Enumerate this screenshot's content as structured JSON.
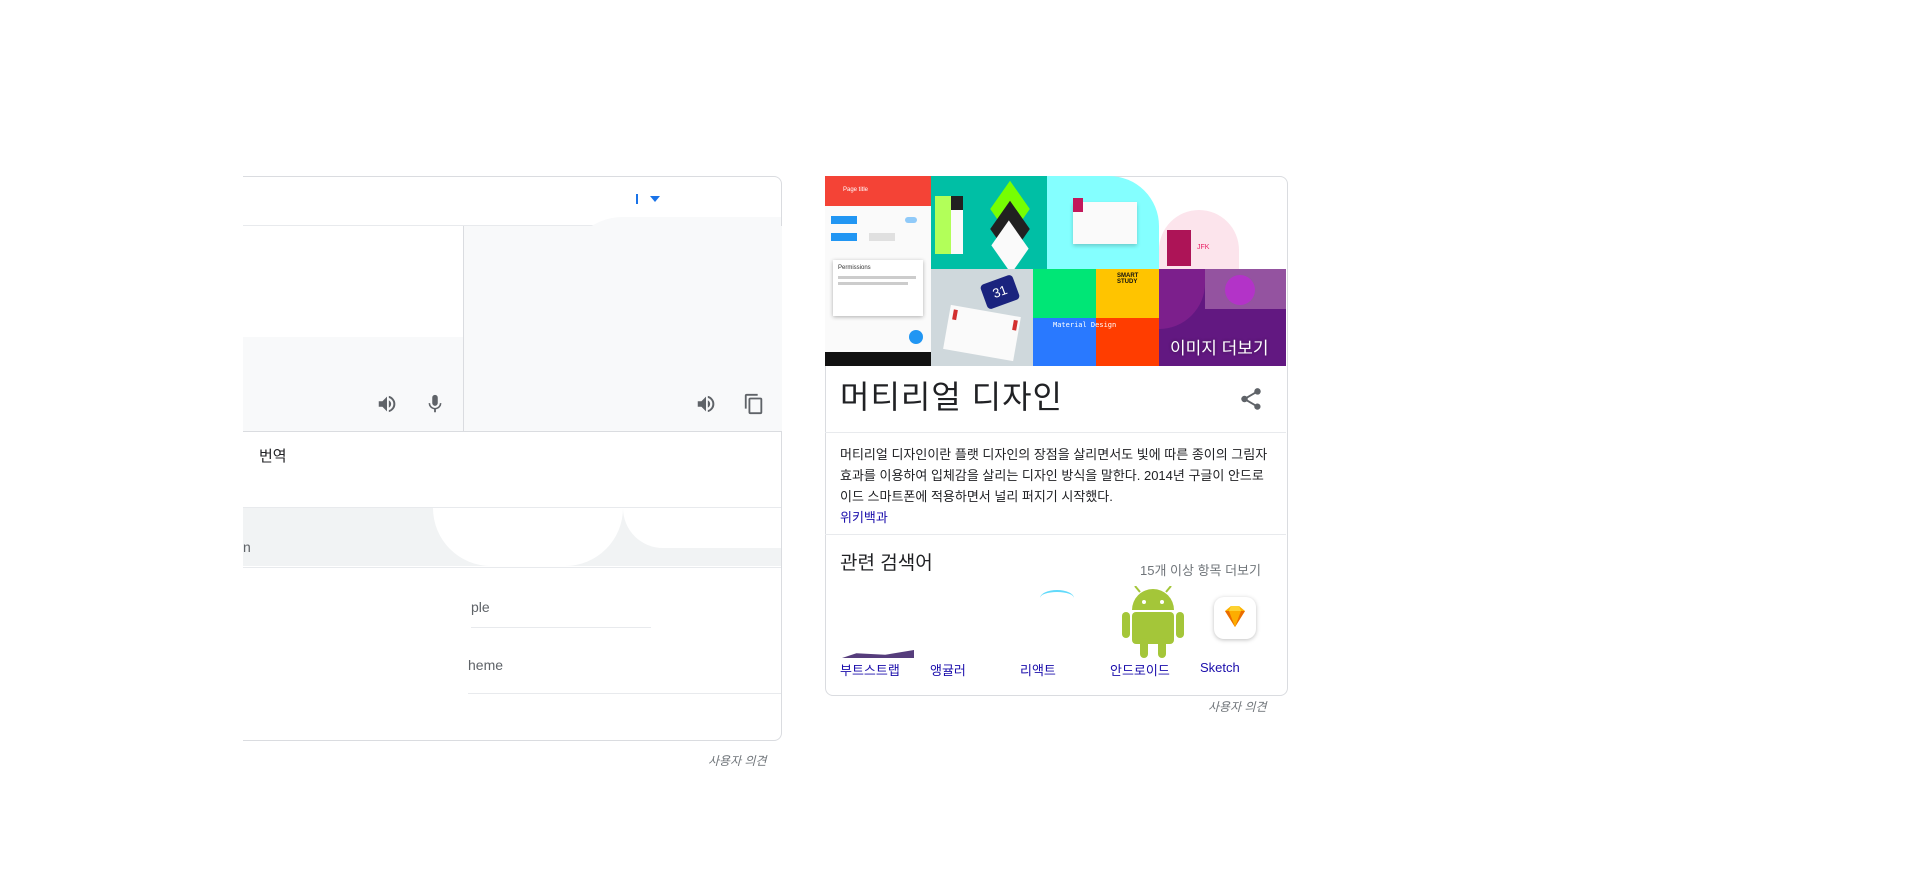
{
  "translate": {
    "open_translate_text": "번역",
    "row1_text": "n",
    "row2_text": "ple",
    "row3_text": "heme",
    "feedback_label": "사용자 의견"
  },
  "knowledge_panel": {
    "title": "머티리얼 디자인",
    "more_images_label": "이미지 더보기",
    "description": "머티리얼 디자인이란 플랫 디자인의 장점을 살리면서도 빛에 따른 종이의 그림자 효과를 이용하여 입체감을 살리는 디자인 방식을 말한다. 2014년 구글이 안드로이드 스마트폰에 적용하면서 널리 퍼지기 시작했다.",
    "source_label": "위키백과",
    "related_heading": "관련 검색어",
    "related_more_label": "15개 이상 항목 더보기",
    "related_items": [
      {
        "label": "부트스트랩",
        "icon": "bootstrap-icon"
      },
      {
        "label": "앵귤러",
        "icon": "angular-icon"
      },
      {
        "label": "리액트",
        "icon": "react-icon"
      },
      {
        "label": "안드로이드",
        "icon": "android-icon"
      },
      {
        "label": "Sketch",
        "icon": "sketch-icon"
      }
    ],
    "feedback_label": "사용자 의견",
    "thumbnail_texts": {
      "app_bar_title": "Page title",
      "dialog_title": "Permissions",
      "calendar_day": "31",
      "smart_study": "SMART STUDY",
      "material_design": "Material Design"
    }
  },
  "colors": {
    "accent_blue": "#1a73e8",
    "link_blue": "#1a0dab",
    "android_green": "#a4c639"
  }
}
